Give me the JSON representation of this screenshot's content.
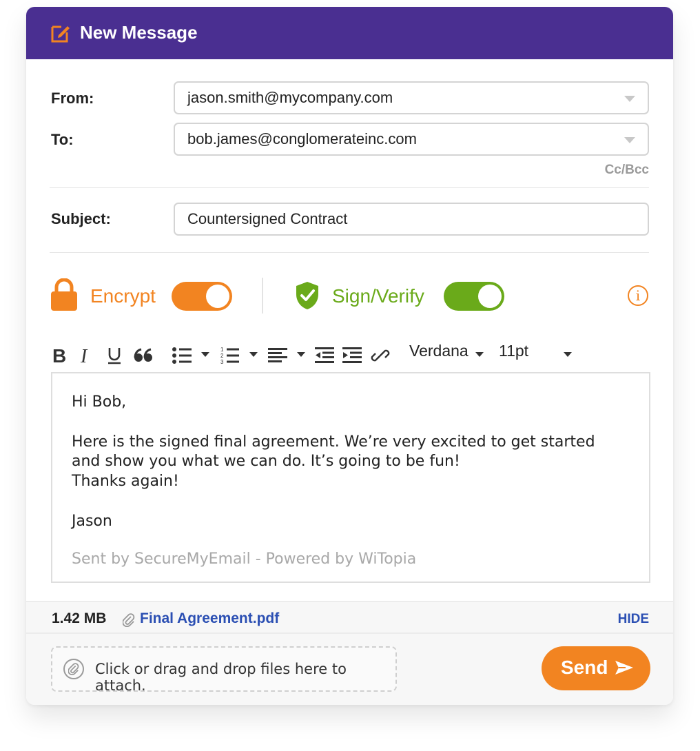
{
  "header": {
    "title": "New Message"
  },
  "from": {
    "label": "From:",
    "value": "jason.smith@mycompany.com"
  },
  "to": {
    "label": "To:",
    "value": "bob.james@conglomerateinc.com",
    "cc_bcc": "Cc/Bcc"
  },
  "subject": {
    "label": "Subject:",
    "value": "Countersigned Contract"
  },
  "toggles": {
    "encrypt": {
      "label": "Encrypt",
      "on": true,
      "color": "#f28421"
    },
    "sign": {
      "label": "Sign/Verify",
      "on": true,
      "color": "#6aaa1a"
    },
    "info_icon": "info-icon"
  },
  "toolbar": {
    "font": "Verdana",
    "size": "11pt",
    "icons": [
      "bold-icon",
      "italic-icon",
      "underline-icon",
      "quote-icon",
      "bullet-list-icon",
      "numbered-list-icon",
      "align-icon",
      "outdent-icon",
      "indent-icon",
      "link-icon"
    ]
  },
  "body": {
    "greeting": "Hi Bob,",
    "line1": "Here is the signed final agreement. We’re very excited to get started",
    "line2": "and show you what we can do. It’s going to be fun!",
    "line3": "Thanks again!",
    "signoff": "Jason",
    "signature": "Sent by SecureMyEmail - Powered by WiTopia"
  },
  "attachment": {
    "size": "1.42 MB",
    "name": "Final Agreement.pdf",
    "hide_label": "HIDE"
  },
  "footer": {
    "dropzone_text": "Click or drag and drop files here to attach.",
    "send_label": "Send"
  },
  "colors": {
    "header_bg": "#4a2f91",
    "accent_orange": "#f28421",
    "accent_green": "#6aaa1a",
    "link_blue": "#2b4fb3"
  }
}
